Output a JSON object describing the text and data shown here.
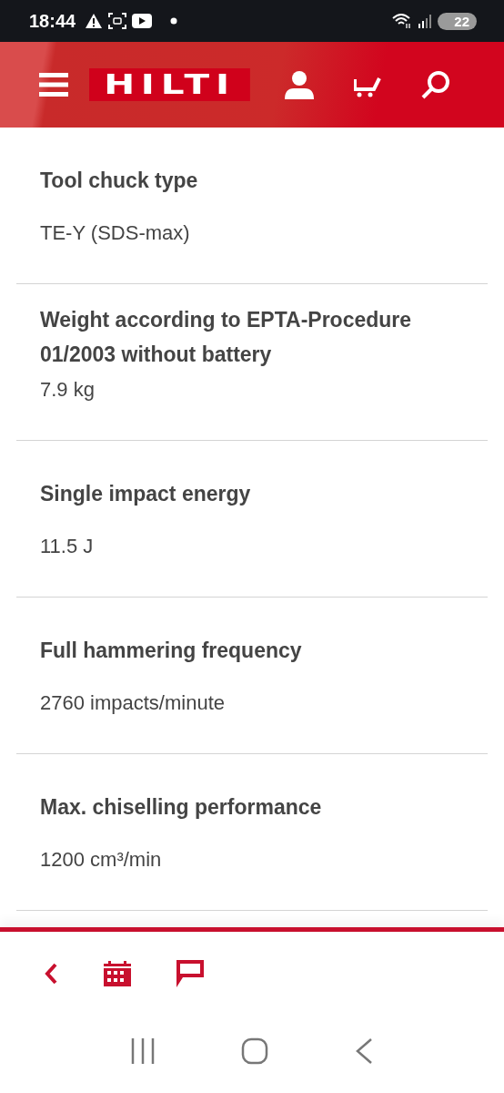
{
  "status_bar": {
    "time": "18:44",
    "battery": "22"
  },
  "header": {
    "logo": "HILTI"
  },
  "specs": [
    {
      "label": "Tool chuck type",
      "value": "TE-Y (SDS-max)"
    },
    {
      "label": "Weight according to EPTA-Procedure 01/2003 without battery",
      "value": "7.9 kg"
    },
    {
      "label": "Single impact energy",
      "value": "11.5 J"
    },
    {
      "label": "Full hammering frequency",
      "value": "2760 impacts/minute"
    },
    {
      "label": "Max. chiselling performance",
      "value": "1200 cm³/min"
    }
  ]
}
